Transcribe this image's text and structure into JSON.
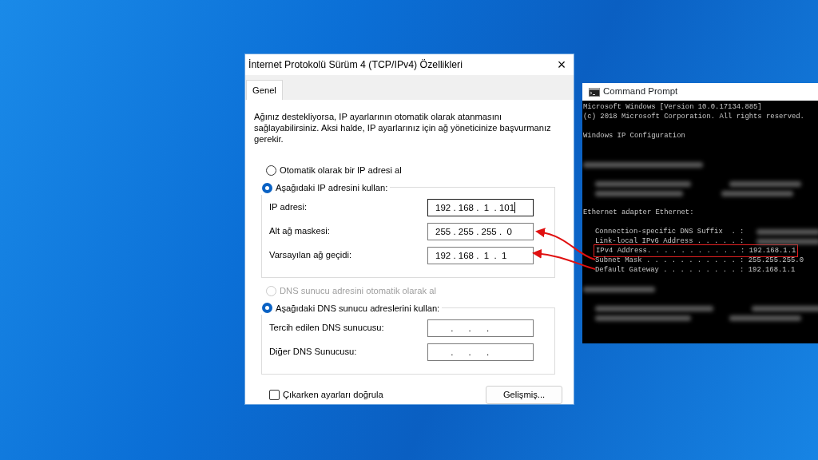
{
  "dialog": {
    "title": "İnternet Protokolü Sürüm 4 (TCP/IPv4) Özellikleri",
    "close": "×",
    "tabs": [
      {
        "label": "Genel",
        "selected": true
      }
    ],
    "description": "Ağınız destekliyorsa, IP ayarlarının otomatik olarak atanmasını sağlayabilirsiniz. Aksi halde, IP ayarlarınız için ağ yöneticinize başvurmanız gerekir.",
    "ip_mode": [
      {
        "label": "Otomatik olarak bir IP adresi al",
        "selected": false,
        "disabled": false
      },
      {
        "label": "Aşağıdaki IP adresini kullan:",
        "selected": true,
        "disabled": false
      }
    ],
    "ip_fields": [
      {
        "label": "IP adresi:",
        "value": "192 . 168 .  1  . 101",
        "focused": true
      },
      {
        "label": "Alt ağ maskesi:",
        "value": "255 . 255 . 255 .  0",
        "focused": false
      },
      {
        "label": "Varsayılan ağ geçidi:",
        "value": "192 . 168 .  1  .  1",
        "focused": false
      }
    ],
    "dns_mode": [
      {
        "label": "DNS sunucu adresini otomatik olarak al",
        "selected": false,
        "disabled": true
      },
      {
        "label": "Aşağıdaki DNS sunucu adreslerini kullan:",
        "selected": true,
        "disabled": false
      }
    ],
    "dns_fields": [
      {
        "label": "Tercih edilen DNS sunucusu:",
        "value": "      .      .      .",
        "focused": false
      },
      {
        "label": "Diğer DNS Sunucusu:",
        "value": "      .      .      .",
        "focused": false
      }
    ],
    "validate": {
      "label": "Çıkarken ayarları doğrula",
      "checked": false
    },
    "advanced_button": "Gelişmiş..."
  },
  "console": {
    "title": "Command Prompt",
    "lines": [
      {
        "kind": "text",
        "text": "Microsoft Windows [Version 10.0.17134.885]"
      },
      {
        "kind": "text",
        "text": "(c) 2018 Microsoft Corporation. All rights reserved."
      },
      {
        "kind": "blank"
      },
      {
        "kind": "text",
        "text": "Windows IP Configuration"
      },
      {
        "kind": "blank"
      },
      {
        "kind": "blank"
      },
      {
        "kind": "blurred"
      },
      {
        "kind": "blank"
      },
      {
        "kind": "blurred",
        "indent": true
      },
      {
        "kind": "blurred",
        "indent": true
      },
      {
        "kind": "blank"
      },
      {
        "kind": "text",
        "text": "Ethernet adapter Ethernet:"
      },
      {
        "kind": "blank"
      },
      {
        "kind": "text",
        "text": "Connection-specific DNS Suffix  . :",
        "indent": true,
        "blurred_tail": true
      },
      {
        "kind": "text",
        "text": "Link-local IPv6 Address . . . . . :",
        "indent": true,
        "blurred_tail": true
      },
      {
        "kind": "text",
        "text": "IPv4 Address. . . . . . . . . . . : 192.168.1.1",
        "indent": true,
        "highlighted": true
      },
      {
        "kind": "text",
        "text": "Subnet Mask . . . . . . . . . . . : 255.255.255.0",
        "indent": true
      },
      {
        "kind": "text",
        "text": "Default Gateway . . . . . . . . . : 192.168.1.1",
        "indent": true
      },
      {
        "kind": "blank"
      },
      {
        "kind": "blurred"
      },
      {
        "kind": "blank"
      },
      {
        "kind": "blurred",
        "indent": true
      },
      {
        "kind": "blurred",
        "indent": true
      }
    ]
  }
}
